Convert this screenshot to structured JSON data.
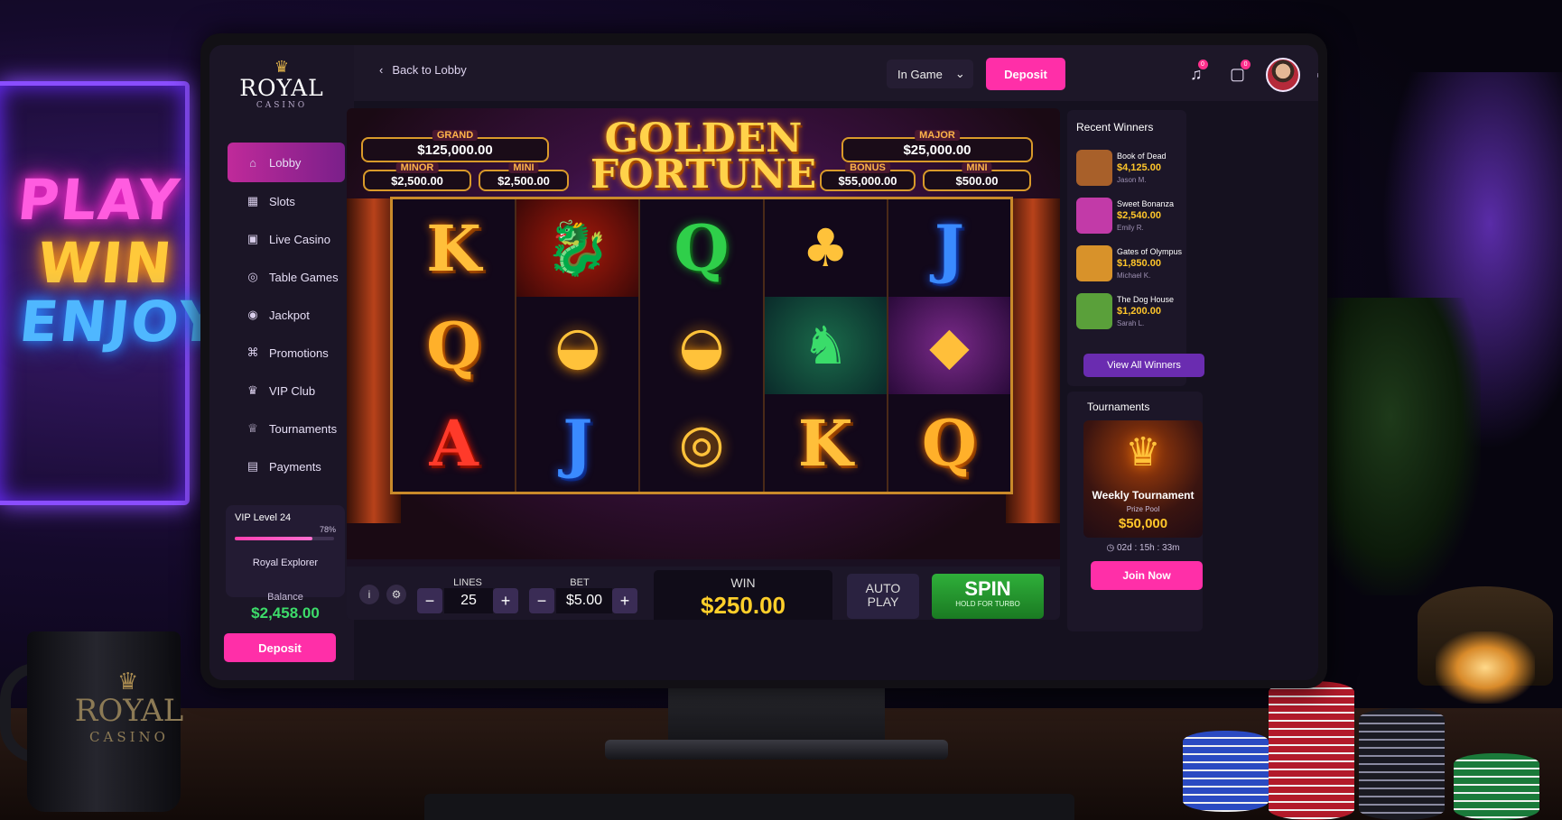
{
  "neon_sign": {
    "line1": "PLAY",
    "line2": "WIN",
    "line3": "ENJOY"
  },
  "mug": {
    "brand": "ROYAL",
    "sub": "CASINO"
  },
  "logo": {
    "name": "ROYAL",
    "sub": "CASINO"
  },
  "sidebar": {
    "items": [
      {
        "label": "Lobby",
        "icon": "home-icon",
        "glyph": "⌂"
      },
      {
        "label": "Slots",
        "icon": "slots-icon",
        "glyph": "▦"
      },
      {
        "label": "Live Casino",
        "icon": "live-casino-icon",
        "glyph": "▣"
      },
      {
        "label": "Table Games",
        "icon": "table-games-icon",
        "glyph": "◎"
      },
      {
        "label": "Jackpot",
        "icon": "jackpot-icon",
        "glyph": "◉"
      },
      {
        "label": "Promotions",
        "icon": "gift-icon",
        "glyph": "⌘"
      },
      {
        "label": "VIP Club",
        "icon": "vip-icon",
        "glyph": "♛"
      },
      {
        "label": "Tournaments",
        "icon": "trophy-icon",
        "glyph": "♕"
      },
      {
        "label": "Payments",
        "icon": "wallet-icon",
        "glyph": "▤"
      }
    ],
    "vip": {
      "level": "VIP Level 24",
      "percent": "78%",
      "progress": 0.78,
      "rank": "Royal Explorer"
    },
    "balance_label": "Balance",
    "balance_value": "$2,458.00",
    "deposit_label": "Deposit"
  },
  "topbar": {
    "back_label": "Back to Lobby",
    "status": "In Game",
    "deposit_label": "Deposit",
    "notif_count_1": "0",
    "notif_count_2": "0"
  },
  "game": {
    "title_line1": "GOLDEN",
    "title_line2": "FORTUNE",
    "jackpots": {
      "grand": {
        "tag": "GRAND",
        "value": "$125,000.00"
      },
      "major": {
        "tag": "MAJOR",
        "value": "$25,000.00"
      },
      "minor": {
        "tag": "MINOR",
        "value": "$2,500.00"
      },
      "mini": {
        "tag": "MINI",
        "value": "$2,500.00"
      },
      "left2": {
        "tag": "BONUS",
        "value": "$55,000.00"
      },
      "right2": {
        "tag": "MINI",
        "value": "$500.00"
      }
    },
    "reels": [
      [
        {
          "s": "K",
          "c": "s-K"
        },
        {
          "s": "Q",
          "c": "s-Qg"
        },
        {
          "s": "A",
          "c": "s-A"
        }
      ],
      [
        {
          "s": "🐉",
          "c": "s-img s-dragon"
        },
        {
          "s": "◒",
          "c": "s-img s-ingot"
        },
        {
          "s": "J",
          "c": "s-J"
        }
      ],
      [
        {
          "s": "Q",
          "c": "s-Q"
        },
        {
          "s": "◒",
          "c": "s-img s-ingot"
        },
        {
          "s": "◎",
          "c": "s-img s-coin"
        }
      ],
      [
        {
          "s": "♣",
          "c": "s-img s-tree"
        },
        {
          "s": "♞",
          "c": "s-img s-lion"
        },
        {
          "s": "K",
          "c": "s-K"
        }
      ],
      [
        {
          "s": "J",
          "c": "s-J"
        },
        {
          "s": "◆",
          "c": "s-img s-turtle"
        },
        {
          "s": "Q",
          "c": "s-Qg"
        }
      ]
    ],
    "controls": {
      "info": "i",
      "settings": "⚙",
      "lines_label": "LINES",
      "lines_value": "25",
      "bet_label": "BET",
      "bet_value": "$5.00",
      "win_label": "WIN",
      "win_value": "$250.00",
      "auto_line1": "AUTO",
      "auto_line2": "PLAY",
      "spin_label": "SPIN",
      "spin_sub": "HOLD FOR TURBO"
    }
  },
  "recent_winners": {
    "title": "Recent Winners",
    "items": [
      {
        "game": "Book of Dead",
        "amount": "$4,125.00",
        "user": "Jason M.",
        "thumb": "#a8602a"
      },
      {
        "game": "Sweet Bonanza",
        "amount": "$2,540.00",
        "user": "Emily R.",
        "thumb": "#c23aa8"
      },
      {
        "game": "Gates of Olympus",
        "amount": "$1,850.00",
        "user": "Michael K.",
        "thumb": "#d8922a"
      },
      {
        "game": "The Dog House",
        "amount": "$1,200.00",
        "user": "Sarah L.",
        "thumb": "#5aa03a"
      }
    ],
    "view_all": "View All Winners"
  },
  "tournaments": {
    "title": "Tournaments",
    "name": "Weekly Tournament",
    "pool_label": "Prize Pool",
    "prize": "$50,000",
    "timer": "02d : 15h : 33m",
    "join_label": "Join Now"
  }
}
